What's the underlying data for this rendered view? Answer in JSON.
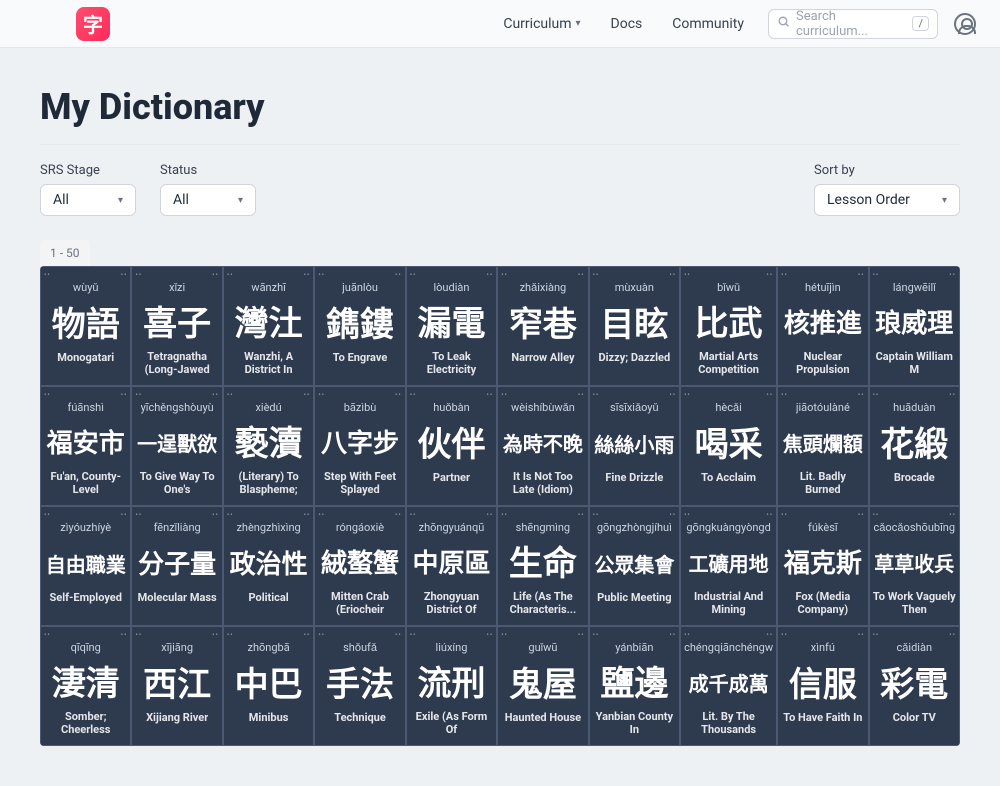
{
  "header": {
    "logo_char": "字",
    "nav": {
      "curriculum": "Curriculum",
      "docs": "Docs",
      "community": "Community"
    },
    "search_placeholder": "Search curriculum...",
    "slash_key": "/"
  },
  "page": {
    "title": "My Dictionary",
    "filters": {
      "srs_label": "SRS Stage",
      "srs_value": "All",
      "status_label": "Status",
      "status_value": "All",
      "sort_label": "Sort by",
      "sort_value": "Lesson Order"
    },
    "range": "1 - 50"
  },
  "cards": [
    {
      "pinyin": "wùyǔ",
      "hanzi": "物語",
      "meaning": "Monogatari"
    },
    {
      "pinyin": "xǐzi",
      "hanzi": "喜子",
      "meaning": "Tetragnatha (Long-Jawed"
    },
    {
      "pinyin": "wānzhī",
      "hanzi": "灣汢",
      "meaning": "Wanzhi, A District In"
    },
    {
      "pinyin": "juānlòu",
      "hanzi": "鐫鏤",
      "meaning": "To Engrave"
    },
    {
      "pinyin": "lòudiàn",
      "hanzi": "漏電",
      "meaning": "To Leak Electricity"
    },
    {
      "pinyin": "zhǎixiàng",
      "hanzi": "窄巷",
      "meaning": "Narrow Alley"
    },
    {
      "pinyin": "mùxuàn",
      "hanzi": "目眩",
      "meaning": "Dizzy; Dazzled"
    },
    {
      "pinyin": "bǐwǔ",
      "hanzi": "比武",
      "meaning": "Martial Arts Competition"
    },
    {
      "pinyin": "hétuījìn",
      "hanzi": "核推進",
      "meaning": "Nuclear Propulsion"
    },
    {
      "pinyin": "lángwēilǐ",
      "hanzi": "琅威理",
      "meaning": "Captain William M"
    },
    {
      "pinyin": "fúānshì",
      "hanzi": "福安市",
      "meaning": "Fu'an, County-Level"
    },
    {
      "pinyin": "yīchěngshòuyù",
      "hanzi": "一逞獸欲",
      "meaning": "To Give Way To One's"
    },
    {
      "pinyin": "xièdú",
      "hanzi": "褻瀆",
      "meaning": "(Literary) To Blaspheme;"
    },
    {
      "pinyin": "bāzìbù",
      "hanzi": "八字步",
      "meaning": "Step With Feet Splayed"
    },
    {
      "pinyin": "huǒbàn",
      "hanzi": "伙伴",
      "meaning": "Partner"
    },
    {
      "pinyin": "wèishíbùwǎn",
      "hanzi": "為時不晚",
      "meaning": "It Is Not Too Late (Idiom)"
    },
    {
      "pinyin": "sīsīxiǎoyǔ",
      "hanzi": "絲絲小雨",
      "meaning": "Fine Drizzle"
    },
    {
      "pinyin": "hècǎi",
      "hanzi": "喝采",
      "meaning": "To Acclaim"
    },
    {
      "pinyin": "jiāotóulàné",
      "hanzi": "焦頭爛額",
      "meaning": "Lit. Badly Burned"
    },
    {
      "pinyin": "huāduàn",
      "hanzi": "花緞",
      "meaning": "Brocade"
    },
    {
      "pinyin": "zìyóuzhíyè",
      "hanzi": "自由職業",
      "meaning": "Self-Employed"
    },
    {
      "pinyin": "fēnzǐliàng",
      "hanzi": "分子量",
      "meaning": "Molecular Mass"
    },
    {
      "pinyin": "zhèngzhìxìng",
      "hanzi": "政治性",
      "meaning": "Political"
    },
    {
      "pinyin": "róngáoxiè",
      "hanzi": "絨螯蟹",
      "meaning": "Mitten Crab (Eriocheir"
    },
    {
      "pinyin": "zhōngyuánqū",
      "hanzi": "中原區",
      "meaning": "Zhongyuan District Of"
    },
    {
      "pinyin": "shēngmìng",
      "hanzi": "生命",
      "meaning": "Life (As The Characteris..."
    },
    {
      "pinyin": "gōngzhòngjíhuì",
      "hanzi": "公眾集會",
      "meaning": "Public Meeting"
    },
    {
      "pinyin": "gōngkuàngyòngd",
      "hanzi": "工礦用地",
      "meaning": "Industrial And Mining"
    },
    {
      "pinyin": "fúkèsī",
      "hanzi": "福克斯",
      "meaning": "Fox (Media Company)"
    },
    {
      "pinyin": "cǎocǎoshōubīng",
      "hanzi": "草草收兵",
      "meaning": "To Work Vaguely Then"
    },
    {
      "pinyin": "qīqīng",
      "hanzi": "淒清",
      "meaning": "Somber; Cheerless"
    },
    {
      "pinyin": "xījiāng",
      "hanzi": "西江",
      "meaning": "Xijiang River"
    },
    {
      "pinyin": "zhōngbā",
      "hanzi": "中巴",
      "meaning": "Minibus"
    },
    {
      "pinyin": "shǒufǎ",
      "hanzi": "手法",
      "meaning": "Technique"
    },
    {
      "pinyin": "liúxíng",
      "hanzi": "流刑",
      "meaning": "Exile (As Form Of"
    },
    {
      "pinyin": "guǐwū",
      "hanzi": "鬼屋",
      "meaning": "Haunted House"
    },
    {
      "pinyin": "yánbiān",
      "hanzi": "鹽邊",
      "meaning": "Yanbian County In"
    },
    {
      "pinyin": "chéngqiānchéngw",
      "hanzi": "成千成萬",
      "meaning": "Lit. By The Thousands"
    },
    {
      "pinyin": "xìnfú",
      "hanzi": "信服",
      "meaning": "To Have Faith In"
    },
    {
      "pinyin": "cǎidiàn",
      "hanzi": "彩電",
      "meaning": "Color TV"
    }
  ]
}
